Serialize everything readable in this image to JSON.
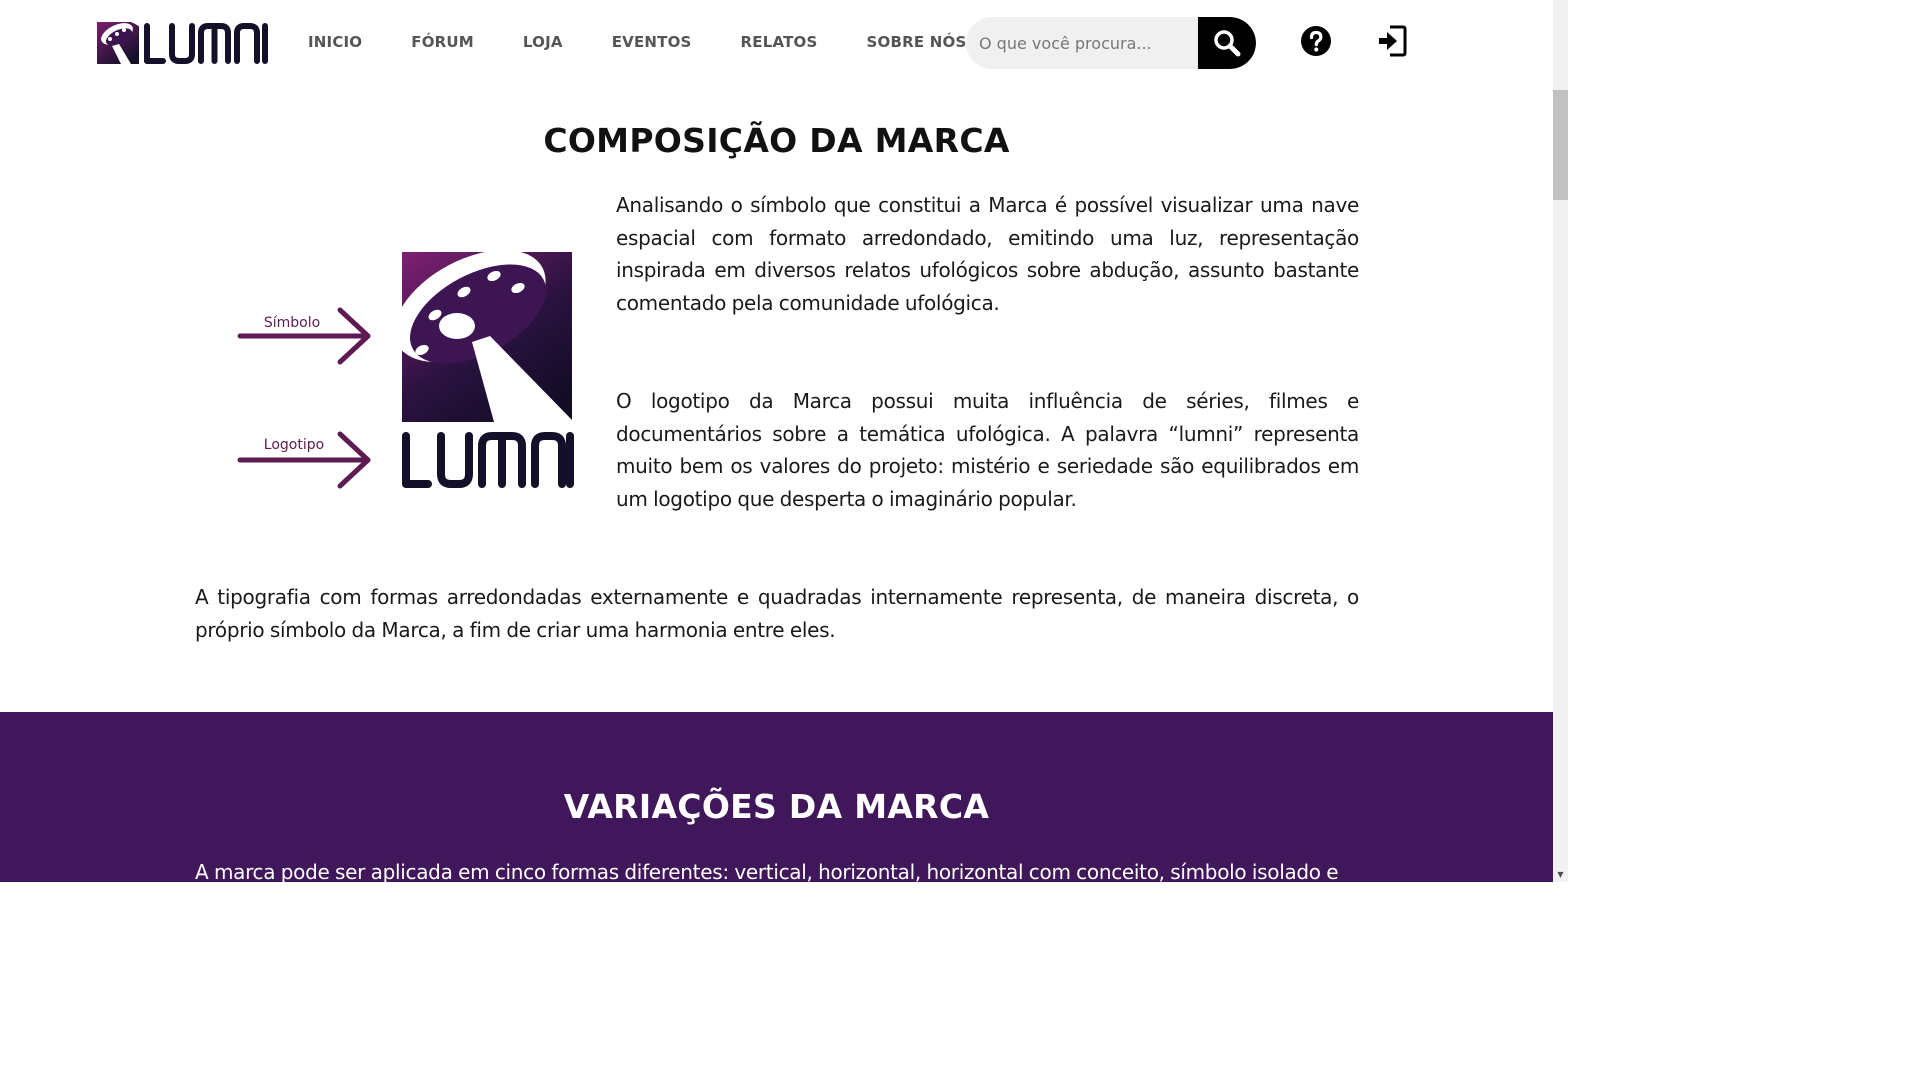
{
  "header": {
    "logo_text": "LUMNI",
    "nav": [
      {
        "label": "INICIO"
      },
      {
        "label": "FÓRUM"
      },
      {
        "label": "LOJA"
      },
      {
        "label": "EVENTOS"
      },
      {
        "label": "RELATOS"
      },
      {
        "label": "SOBRE NÓS"
      }
    ],
    "search": {
      "placeholder": "O que você procura..."
    },
    "icons": {
      "search": "magnifier-icon",
      "help": "question-circle-icon",
      "login": "sign-in-icon"
    }
  },
  "composition": {
    "title": "COMPOSIÇÃO DA MARCA",
    "figure": {
      "symbol_label": "Símbolo",
      "logotype_label": "Logotipo",
      "logo_text": "LUMNI"
    },
    "paragraph_1": "Analisando o símbolo que constitui a Marca é possível visualizar uma nave espacial com formato arredondado, emitindo uma luz, representação inspirada em diversos relatos ufológicos sobre abdução, assunto bastante comentado pela comunidade ufológica.",
    "paragraph_2": "O logotipo da Marca possui muita influência de séries, filmes e documentários sobre a temática ufológica. A palavra “lumni” representa muito bem os valores do projeto: mistério e seriedade são equilibrados em um logotipo que desperta o imaginário popular.",
    "paragraph_3": "A tipografia com formas arredondadas externamente e quadradas internamente representa, de maneira discreta, o próprio símbolo da Marca, a fim de criar uma harmonia entre eles."
  },
  "variations": {
    "title": "VARIAÇÕES DA MARCA",
    "paragraph_1": "A marca pode ser aplicada em cinco formas diferentes: vertical, horizontal, horizontal com conceito, símbolo isolado e"
  },
  "colors": {
    "brand_purple": "#40175a",
    "accent_purple": "#5e1a52",
    "symbol_gradient_top": "#7a1f6e",
    "symbol_gradient_bottom": "#1a0f2e"
  }
}
